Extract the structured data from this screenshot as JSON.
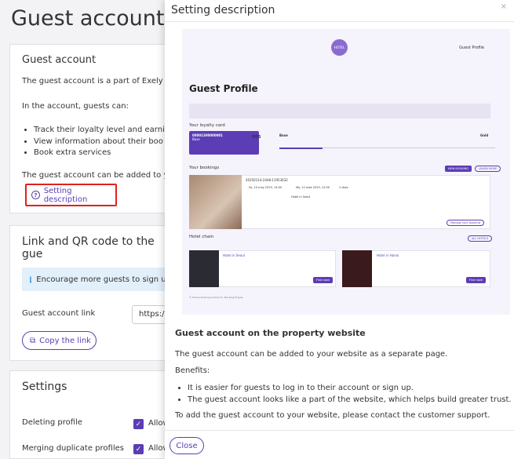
{
  "page": {
    "title": "Guest account"
  },
  "guest_card": {
    "heading": "Guest account",
    "intro": "The guest account is a part of Exely Boo",
    "guests_can": "In the account, guests can:",
    "bullets": [
      "Track their loyalty level and earnin",
      "View information about their boo",
      "Book extra services"
    ],
    "added_text": "The guest account can be added to your",
    "setting_link": "Setting description"
  },
  "link_card": {
    "heading": "Link and QR code to the gue",
    "info": "Encourage more guests to sign up",
    "link_label": "Guest account link",
    "link_value": "https:/",
    "copy_button": "Copy the link"
  },
  "settings_card": {
    "heading": "Settings",
    "rows": [
      {
        "label": "Deleting profile",
        "option": "Allow"
      },
      {
        "label": "Merging duplicate profiles",
        "option": "Allow"
      }
    ]
  },
  "modal": {
    "title": "Setting description",
    "close_icon": "×",
    "preview": {
      "logo": "HOTEL",
      "user": "Guest Profile",
      "heading": "Guest Profile",
      "loyalty_title": "Your loyalty card",
      "card_number": "00001300000001",
      "card_level": "Base",
      "points": "505",
      "level_from": "Base",
      "level_to": "Gold",
      "bookings_title": "Your bookings",
      "new_booking": "NEW BOOKING",
      "learn_more": "LEARN MORE",
      "booking_id": "20250114-2448-11953632",
      "booking_from": "Sa, 10 may 2025, 14:00",
      "booking_to": "Mo, 12 mae 2025, 12:00",
      "nights": "2 days",
      "hotel_seoul": "Hotel in Seoul",
      "manage": "Manage your booking",
      "chain_title": "Hotel chain",
      "all_hotels": "ALL HOTELS",
      "hotel1": "Hotel in Seoul",
      "hotel2": "Hotel in Hanoi",
      "find_room": "Find room",
      "footer": "© Online booking module TL: Booking Engine"
    },
    "heading": "Guest account on the property website",
    "p1": "The guest account can be added to your website as a separate page.",
    "benefits": "Benefits:",
    "bullets": [
      "It is easier for guests to log in to their account or sign up.",
      "The guest account looks like a part of the website, which helps build greater trust."
    ],
    "p2": "To add the guest account to your website, please contact the customer support.",
    "close_button": "Close"
  }
}
